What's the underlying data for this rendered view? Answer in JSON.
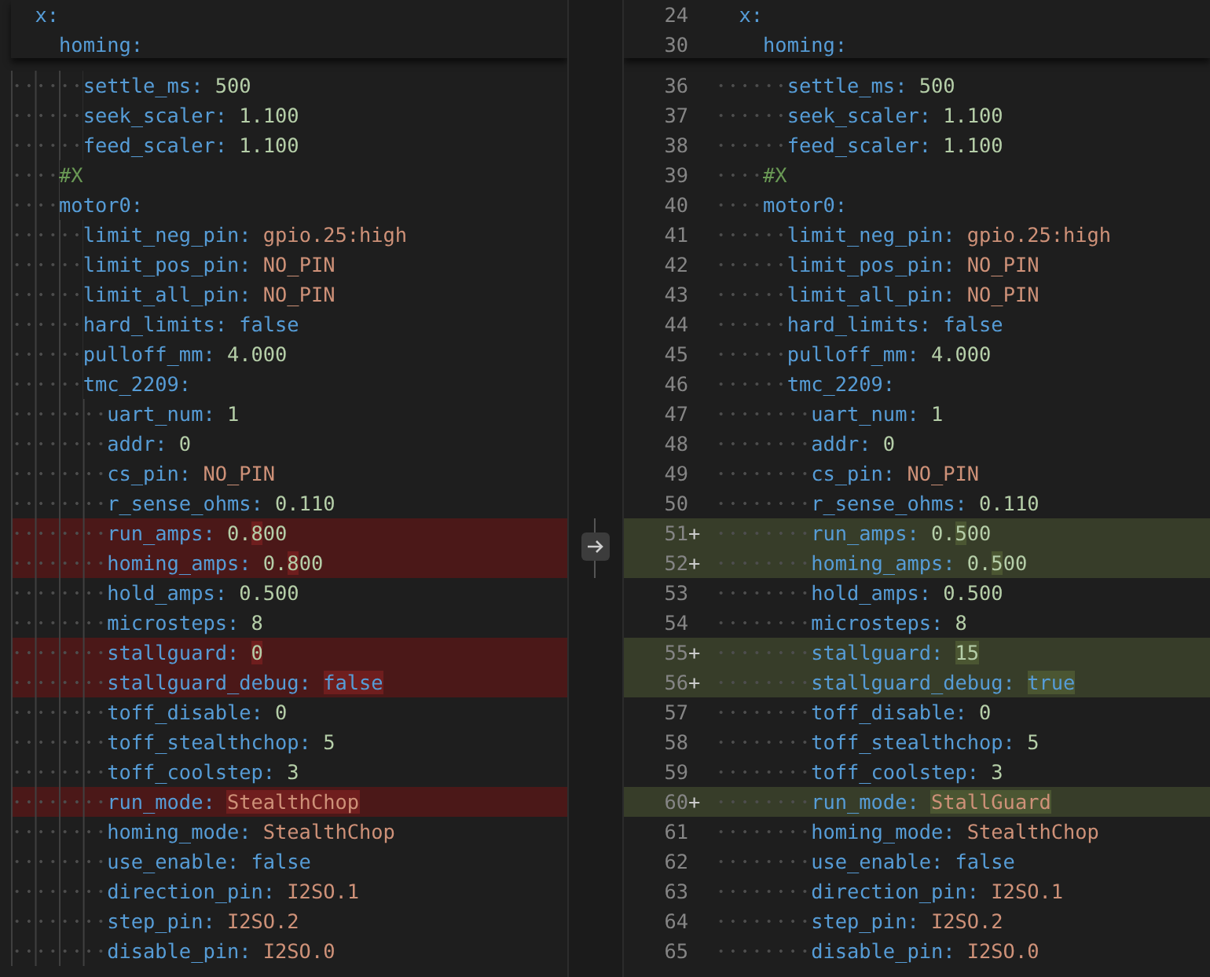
{
  "panes": [
    {
      "tree": [
        {
          "key": "x:",
          "kind": "entry",
          "removed": false,
          "children": [
            {
              "key": "homing:",
              "kind": "entry",
              "removed": false,
              "children": [
                {
                  "key": "settle_ms:",
                  "kind": "entry",
                  "removed": false,
                  "value": {
                    "kind": "number",
                    "parts": [
                      {
                        "text": "500",
                        "changed": false
                      }
                    ]
                  }
                },
                {
                  "key": "seek_scaler:",
                  "kind": "entry",
                  "removed": false,
                  "value": {
                    "kind": "number",
                    "parts": [
                      {
                        "text": "1.100",
                        "changed": false
                      }
                    ]
                  }
                },
                {
                  "key": "feed_scaler:",
                  "kind": "entry",
                  "removed": false,
                  "value": {
                    "kind": "number",
                    "parts": [
                      {
                        "text": "1.100",
                        "changed": false
                      }
                    ]
                  }
                }
              ]
            },
            {
              "key": "#X",
              "kind": "comment",
              "removed": false
            },
            {
              "key": "motor0:",
              "kind": "entry",
              "removed": false,
              "children": [
                {
                  "key": "limit_neg_pin:",
                  "kind": "entry",
                  "removed": false,
                  "value": {
                    "kind": "string",
                    "parts": [
                      {
                        "text": "gpio.25:high",
                        "changed": false
                      }
                    ]
                  }
                },
                {
                  "key": "limit_pos_pin:",
                  "kind": "entry",
                  "removed": false,
                  "value": {
                    "kind": "string",
                    "parts": [
                      {
                        "text": "NO_PIN",
                        "changed": false
                      }
                    ]
                  }
                },
                {
                  "key": "limit_all_pin:",
                  "kind": "entry",
                  "removed": false,
                  "value": {
                    "kind": "string",
                    "parts": [
                      {
                        "text": "NO_PIN",
                        "changed": false
                      }
                    ]
                  }
                },
                {
                  "key": "hard_limits:",
                  "kind": "entry",
                  "removed": false,
                  "value": {
                    "kind": "bool",
                    "parts": [
                      {
                        "text": "false",
                        "changed": false
                      }
                    ]
                  }
                },
                {
                  "key": "pulloff_mm:",
                  "kind": "entry",
                  "removed": false,
                  "value": {
                    "kind": "number",
                    "parts": [
                      {
                        "text": "4.000",
                        "changed": false
                      }
                    ]
                  }
                },
                {
                  "key": "tmc_2209:",
                  "kind": "entry",
                  "removed": false,
                  "children": [
                    {
                      "key": "uart_num:",
                      "kind": "entry",
                      "removed": false,
                      "value": {
                        "kind": "number",
                        "parts": [
                          {
                            "text": "1",
                            "changed": false
                          }
                        ]
                      }
                    },
                    {
                      "key": "addr:",
                      "kind": "entry",
                      "removed": false,
                      "value": {
                        "kind": "number",
                        "parts": [
                          {
                            "text": "0",
                            "changed": false
                          }
                        ]
                      }
                    },
                    {
                      "key": "cs_pin:",
                      "kind": "entry",
                      "removed": false,
                      "value": {
                        "kind": "string",
                        "parts": [
                          {
                            "text": "NO_PIN",
                            "changed": false
                          }
                        ]
                      }
                    },
                    {
                      "key": "r_sense_ohms:",
                      "kind": "entry",
                      "removed": false,
                      "value": {
                        "kind": "number",
                        "parts": [
                          {
                            "text": "0.110",
                            "changed": false
                          }
                        ]
                      }
                    },
                    {
                      "key": "run_amps:",
                      "kind": "entry",
                      "removed": true,
                      "value": {
                        "kind": "number",
                        "parts": [
                          {
                            "text": "0.",
                            "changed": false
                          },
                          {
                            "text": "8",
                            "changed": true
                          },
                          {
                            "text": "00",
                            "changed": false
                          }
                        ]
                      }
                    },
                    {
                      "key": "homing_amps:",
                      "kind": "entry",
                      "removed": true,
                      "value": {
                        "kind": "number",
                        "parts": [
                          {
                            "text": "0.",
                            "changed": false
                          },
                          {
                            "text": "8",
                            "changed": true
                          },
                          {
                            "text": "00",
                            "changed": false
                          }
                        ]
                      }
                    },
                    {
                      "key": "hold_amps:",
                      "kind": "entry",
                      "removed": false,
                      "value": {
                        "kind": "number",
                        "parts": [
                          {
                            "text": "0.500",
                            "changed": false
                          }
                        ]
                      }
                    },
                    {
                      "key": "microsteps:",
                      "kind": "entry",
                      "removed": false,
                      "value": {
                        "kind": "number",
                        "parts": [
                          {
                            "text": "8",
                            "changed": false
                          }
                        ]
                      }
                    },
                    {
                      "key": "stallguard:",
                      "kind": "entry",
                      "removed": true,
                      "value": {
                        "kind": "number",
                        "parts": [
                          {
                            "text": "0",
                            "changed": true
                          }
                        ]
                      }
                    },
                    {
                      "key": "stallguard_debug:",
                      "kind": "entry",
                      "removed": true,
                      "value": {
                        "kind": "bool",
                        "parts": [
                          {
                            "text": "false",
                            "changed": true
                          }
                        ]
                      }
                    },
                    {
                      "key": "toff_disable:",
                      "kind": "entry",
                      "removed": false,
                      "value": {
                        "kind": "number",
                        "parts": [
                          {
                            "text": "0",
                            "changed": false
                          }
                        ]
                      }
                    },
                    {
                      "key": "toff_stealthchop:",
                      "kind": "entry",
                      "removed": false,
                      "value": {
                        "kind": "number",
                        "parts": [
                          {
                            "text": "5",
                            "changed": false
                          }
                        ]
                      }
                    },
                    {
                      "key": "toff_coolstep:",
                      "kind": "entry",
                      "removed": false,
                      "value": {
                        "kind": "number",
                        "parts": [
                          {
                            "text": "3",
                            "changed": false
                          }
                        ]
                      }
                    },
                    {
                      "key": "run_mode:",
                      "kind": "entry",
                      "removed": true,
                      "value": {
                        "kind": "string",
                        "parts": [
                          {
                            "text": "StealthChop",
                            "changed": true
                          }
                        ]
                      }
                    },
                    {
                      "key": "homing_mode:",
                      "kind": "entry",
                      "removed": false,
                      "value": {
                        "kind": "string",
                        "parts": [
                          {
                            "text": "StealthChop",
                            "changed": false
                          }
                        ]
                      }
                    },
                    {
                      "key": "use_enable:",
                      "kind": "entry",
                      "removed": false,
                      "value": {
                        "kind": "bool",
                        "parts": [
                          {
                            "text": "false",
                            "changed": false
                          }
                        ]
                      }
                    },
                    {
                      "key": "direction_pin:",
                      "kind": "entry",
                      "removed": false,
                      "value": {
                        "kind": "string",
                        "parts": [
                          {
                            "text": "I2SO.1",
                            "changed": false
                          }
                        ]
                      }
                    },
                    {
                      "key": "step_pin:",
                      "kind": "entry",
                      "removed": false,
                      "value": {
                        "kind": "string",
                        "parts": [
                          {
                            "text": "I2SO.2",
                            "changed": false
                          }
                        ]
                      }
                    },
                    {
                      "key": "disable_pin:",
                      "kind": "entry",
                      "removed": false,
                      "value": {
                        "kind": "string",
                        "parts": [
                          {
                            "text": "I2SO.0",
                            "changed": false
                          }
                        ]
                      }
                    }
                  ]
                }
              ]
            }
          ]
        }
      ]
    },
    {
      "tree": [
        {
          "line": "24",
          "key": "x:",
          "kind": "entry",
          "added": false,
          "children": [
            {
              "line": "30",
              "key": "homing:",
              "kind": "entry",
              "added": false,
              "children": [
                {
                  "line": "36",
                  "key": "settle_ms:",
                  "kind": "entry",
                  "added": false,
                  "value": {
                    "kind": "number",
                    "parts": [
                      {
                        "text": "500",
                        "changed": false
                      }
                    ]
                  }
                },
                {
                  "line": "37",
                  "key": "seek_scaler:",
                  "kind": "entry",
                  "added": false,
                  "value": {
                    "kind": "number",
                    "parts": [
                      {
                        "text": "1.100",
                        "changed": false
                      }
                    ]
                  }
                },
                {
                  "line": "38",
                  "key": "feed_scaler:",
                  "kind": "entry",
                  "added": false,
                  "value": {
                    "kind": "number",
                    "parts": [
                      {
                        "text": "1.100",
                        "changed": false
                      }
                    ]
                  }
                }
              ]
            },
            {
              "line": "39",
              "key": "#X",
              "kind": "comment",
              "added": false
            },
            {
              "line": "40",
              "key": "motor0:",
              "kind": "entry",
              "added": false,
              "children": [
                {
                  "line": "41",
                  "key": "limit_neg_pin:",
                  "kind": "entry",
                  "added": false,
                  "value": {
                    "kind": "string",
                    "parts": [
                      {
                        "text": "gpio.25:high",
                        "changed": false
                      }
                    ]
                  }
                },
                {
                  "line": "42",
                  "key": "limit_pos_pin:",
                  "kind": "entry",
                  "added": false,
                  "value": {
                    "kind": "string",
                    "parts": [
                      {
                        "text": "NO_PIN",
                        "changed": false
                      }
                    ]
                  }
                },
                {
                  "line": "43",
                  "key": "limit_all_pin:",
                  "kind": "entry",
                  "added": false,
                  "value": {
                    "kind": "string",
                    "parts": [
                      {
                        "text": "NO_PIN",
                        "changed": false
                      }
                    ]
                  }
                },
                {
                  "line": "44",
                  "key": "hard_limits:",
                  "kind": "entry",
                  "added": false,
                  "value": {
                    "kind": "bool",
                    "parts": [
                      {
                        "text": "false",
                        "changed": false
                      }
                    ]
                  }
                },
                {
                  "line": "45",
                  "key": "pulloff_mm:",
                  "kind": "entry",
                  "added": false,
                  "value": {
                    "kind": "number",
                    "parts": [
                      {
                        "text": "4.000",
                        "changed": false
                      }
                    ]
                  }
                },
                {
                  "line": "46",
                  "key": "tmc_2209:",
                  "kind": "entry",
                  "added": false,
                  "children": [
                    {
                      "line": "47",
                      "key": "uart_num:",
                      "kind": "entry",
                      "added": false,
                      "value": {
                        "kind": "number",
                        "parts": [
                          {
                            "text": "1",
                            "changed": false
                          }
                        ]
                      }
                    },
                    {
                      "line": "48",
                      "key": "addr:",
                      "kind": "entry",
                      "added": false,
                      "value": {
                        "kind": "number",
                        "parts": [
                          {
                            "text": "0",
                            "changed": false
                          }
                        ]
                      }
                    },
                    {
                      "line": "49",
                      "key": "cs_pin:",
                      "kind": "entry",
                      "added": false,
                      "value": {
                        "kind": "string",
                        "parts": [
                          {
                            "text": "NO_PIN",
                            "changed": false
                          }
                        ]
                      }
                    },
                    {
                      "line": "50",
                      "key": "r_sense_ohms:",
                      "kind": "entry",
                      "added": false,
                      "value": {
                        "kind": "number",
                        "parts": [
                          {
                            "text": "0.110",
                            "changed": false
                          }
                        ]
                      }
                    },
                    {
                      "line": "51",
                      "marker": "+",
                      "key": "run_amps:",
                      "kind": "entry",
                      "added": true,
                      "value": {
                        "kind": "number",
                        "parts": [
                          {
                            "text": "0.",
                            "changed": false
                          },
                          {
                            "text": "5",
                            "changed": true
                          },
                          {
                            "text": "00",
                            "changed": false
                          }
                        ]
                      }
                    },
                    {
                      "line": "52",
                      "marker": "+",
                      "key": "homing_amps:",
                      "kind": "entry",
                      "added": true,
                      "value": {
                        "kind": "number",
                        "parts": [
                          {
                            "text": "0.",
                            "changed": false
                          },
                          {
                            "text": "5",
                            "changed": true
                          },
                          {
                            "text": "00",
                            "changed": false
                          }
                        ]
                      }
                    },
                    {
                      "line": "53",
                      "key": "hold_amps:",
                      "kind": "entry",
                      "added": false,
                      "value": {
                        "kind": "number",
                        "parts": [
                          {
                            "text": "0.500",
                            "changed": false
                          }
                        ]
                      }
                    },
                    {
                      "line": "54",
                      "key": "microsteps:",
                      "kind": "entry",
                      "added": false,
                      "value": {
                        "kind": "number",
                        "parts": [
                          {
                            "text": "8",
                            "changed": false
                          }
                        ]
                      }
                    },
                    {
                      "line": "55",
                      "marker": "+",
                      "key": "stallguard:",
                      "kind": "entry",
                      "added": true,
                      "value": {
                        "kind": "number",
                        "parts": [
                          {
                            "text": "15",
                            "changed": true
                          }
                        ]
                      }
                    },
                    {
                      "line": "56",
                      "marker": "+",
                      "key": "stallguard_debug:",
                      "kind": "entry",
                      "added": true,
                      "value": {
                        "kind": "bool",
                        "parts": [
                          {
                            "text": "true",
                            "changed": true
                          }
                        ]
                      }
                    },
                    {
                      "line": "57",
                      "key": "toff_disable:",
                      "kind": "entry",
                      "added": false,
                      "value": {
                        "kind": "number",
                        "parts": [
                          {
                            "text": "0",
                            "changed": false
                          }
                        ]
                      }
                    },
                    {
                      "line": "58",
                      "key": "toff_stealthchop:",
                      "kind": "entry",
                      "added": false,
                      "value": {
                        "kind": "number",
                        "parts": [
                          {
                            "text": "5",
                            "changed": false
                          }
                        ]
                      }
                    },
                    {
                      "line": "59",
                      "key": "toff_coolstep:",
                      "kind": "entry",
                      "added": false,
                      "value": {
                        "kind": "number",
                        "parts": [
                          {
                            "text": "3",
                            "changed": false
                          }
                        ]
                      }
                    },
                    {
                      "line": "60",
                      "marker": "+",
                      "key": "run_mode:",
                      "kind": "entry",
                      "added": true,
                      "value": {
                        "kind": "string",
                        "parts": [
                          {
                            "text": "StallGuard",
                            "changed": true
                          }
                        ]
                      }
                    },
                    {
                      "line": "61",
                      "key": "homing_mode:",
                      "kind": "entry",
                      "added": false,
                      "value": {
                        "kind": "string",
                        "parts": [
                          {
                            "text": "StealthChop",
                            "changed": false
                          }
                        ]
                      }
                    },
                    {
                      "line": "62",
                      "key": "use_enable:",
                      "kind": "entry",
                      "added": false,
                      "value": {
                        "kind": "bool",
                        "parts": [
                          {
                            "text": "false",
                            "changed": false
                          }
                        ]
                      }
                    },
                    {
                      "line": "63",
                      "key": "direction_pin:",
                      "kind": "entry",
                      "added": false,
                      "value": {
                        "kind": "string",
                        "parts": [
                          {
                            "text": "I2SO.1",
                            "changed": false
                          }
                        ]
                      }
                    },
                    {
                      "line": "64",
                      "key": "step_pin:",
                      "kind": "entry",
                      "added": false,
                      "value": {
                        "kind": "string",
                        "parts": [
                          {
                            "text": "I2SO.2",
                            "changed": false
                          }
                        ]
                      }
                    },
                    {
                      "line": "65",
                      "key": "disable_pin:",
                      "kind": "entry",
                      "added": false,
                      "value": {
                        "kind": "string",
                        "parts": [
                          {
                            "text": "I2SO.0",
                            "changed": false
                          }
                        ]
                      }
                    }
                  ]
                }
              ]
            }
          ]
        }
      ]
    }
  ]
}
